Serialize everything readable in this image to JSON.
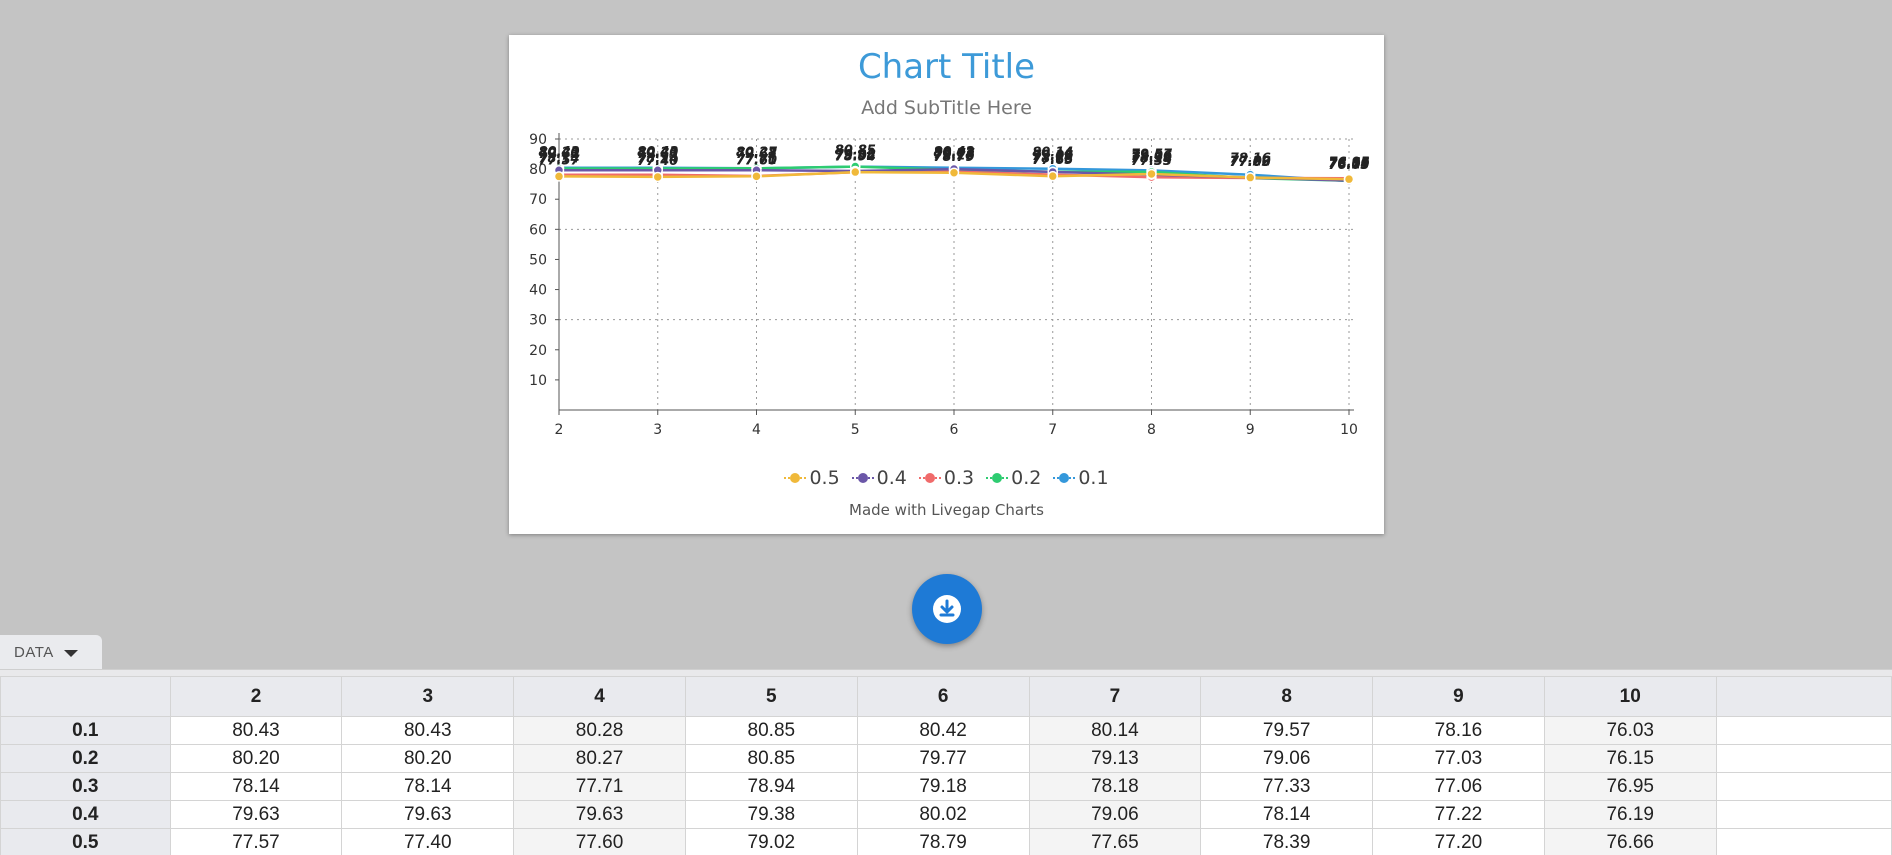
{
  "card": {
    "title": "Chart Title",
    "subtitle": "Add SubTitle Here",
    "credit": "Made with Livegap Charts"
  },
  "data_tab": {
    "label": "DATA"
  },
  "download": {
    "icon": "download-icon"
  },
  "chart_data": {
    "type": "line",
    "title": "Chart Title",
    "subtitle": "Add SubTitle Here",
    "xlabel": "",
    "ylabel": "",
    "x": [
      2,
      3,
      4,
      5,
      6,
      7,
      8,
      9,
      10
    ],
    "ylim": [
      0,
      90
    ],
    "yticks": [
      10,
      20,
      30,
      40,
      50,
      60,
      70,
      80,
      90
    ],
    "grid": true,
    "legend_position": "bottom",
    "series": [
      {
        "name": "0.5",
        "color": "#f0b93a",
        "values": [
          77.57,
          77.4,
          77.6,
          79.02,
          78.79,
          77.65,
          78.39,
          77.2,
          76.66
        ]
      },
      {
        "name": "0.4",
        "color": "#6b57a8",
        "values": [
          79.63,
          79.63,
          79.63,
          79.38,
          80.02,
          79.06,
          78.14,
          77.22,
          76.19
        ]
      },
      {
        "name": "0.3",
        "color": "#f06b6b",
        "values": [
          78.14,
          78.14,
          77.71,
          78.94,
          79.18,
          78.18,
          77.33,
          77.06,
          76.95
        ]
      },
      {
        "name": "0.2",
        "color": "#2ecc71",
        "values": [
          80.2,
          80.2,
          80.27,
          80.85,
          79.77,
          79.13,
          79.06,
          77.03,
          76.15
        ]
      },
      {
        "name": "0.1",
        "color": "#3498db",
        "values": [
          80.43,
          80.43,
          80.28,
          80.85,
          80.42,
          80.14,
          79.57,
          78.16,
          76.03
        ]
      }
    ]
  },
  "table": {
    "columns": [
      "",
      "2",
      "3",
      "4",
      "5",
      "6",
      "7",
      "8",
      "9",
      "10",
      ""
    ],
    "rows": [
      {
        "label": "0.1",
        "cells": [
          "80.43",
          "80.43",
          "80.28",
          "80.85",
          "80.42",
          "80.14",
          "79.57",
          "78.16",
          "76.03"
        ]
      },
      {
        "label": "0.2",
        "cells": [
          "80.20",
          "80.20",
          "80.27",
          "80.85",
          "79.77",
          "79.13",
          "79.06",
          "77.03",
          "76.15"
        ]
      },
      {
        "label": "0.3",
        "cells": [
          "78.14",
          "78.14",
          "77.71",
          "78.94",
          "79.18",
          "78.18",
          "77.33",
          "77.06",
          "76.95"
        ]
      },
      {
        "label": "0.4",
        "cells": [
          "79.63",
          "79.63",
          "79.63",
          "79.38",
          "80.02",
          "79.06",
          "78.14",
          "77.22",
          "76.19"
        ]
      },
      {
        "label": "0.5",
        "cells": [
          "77.57",
          "77.40",
          "77.60",
          "79.02",
          "78.79",
          "77.65",
          "78.39",
          "77.20",
          "76.66"
        ]
      }
    ]
  }
}
